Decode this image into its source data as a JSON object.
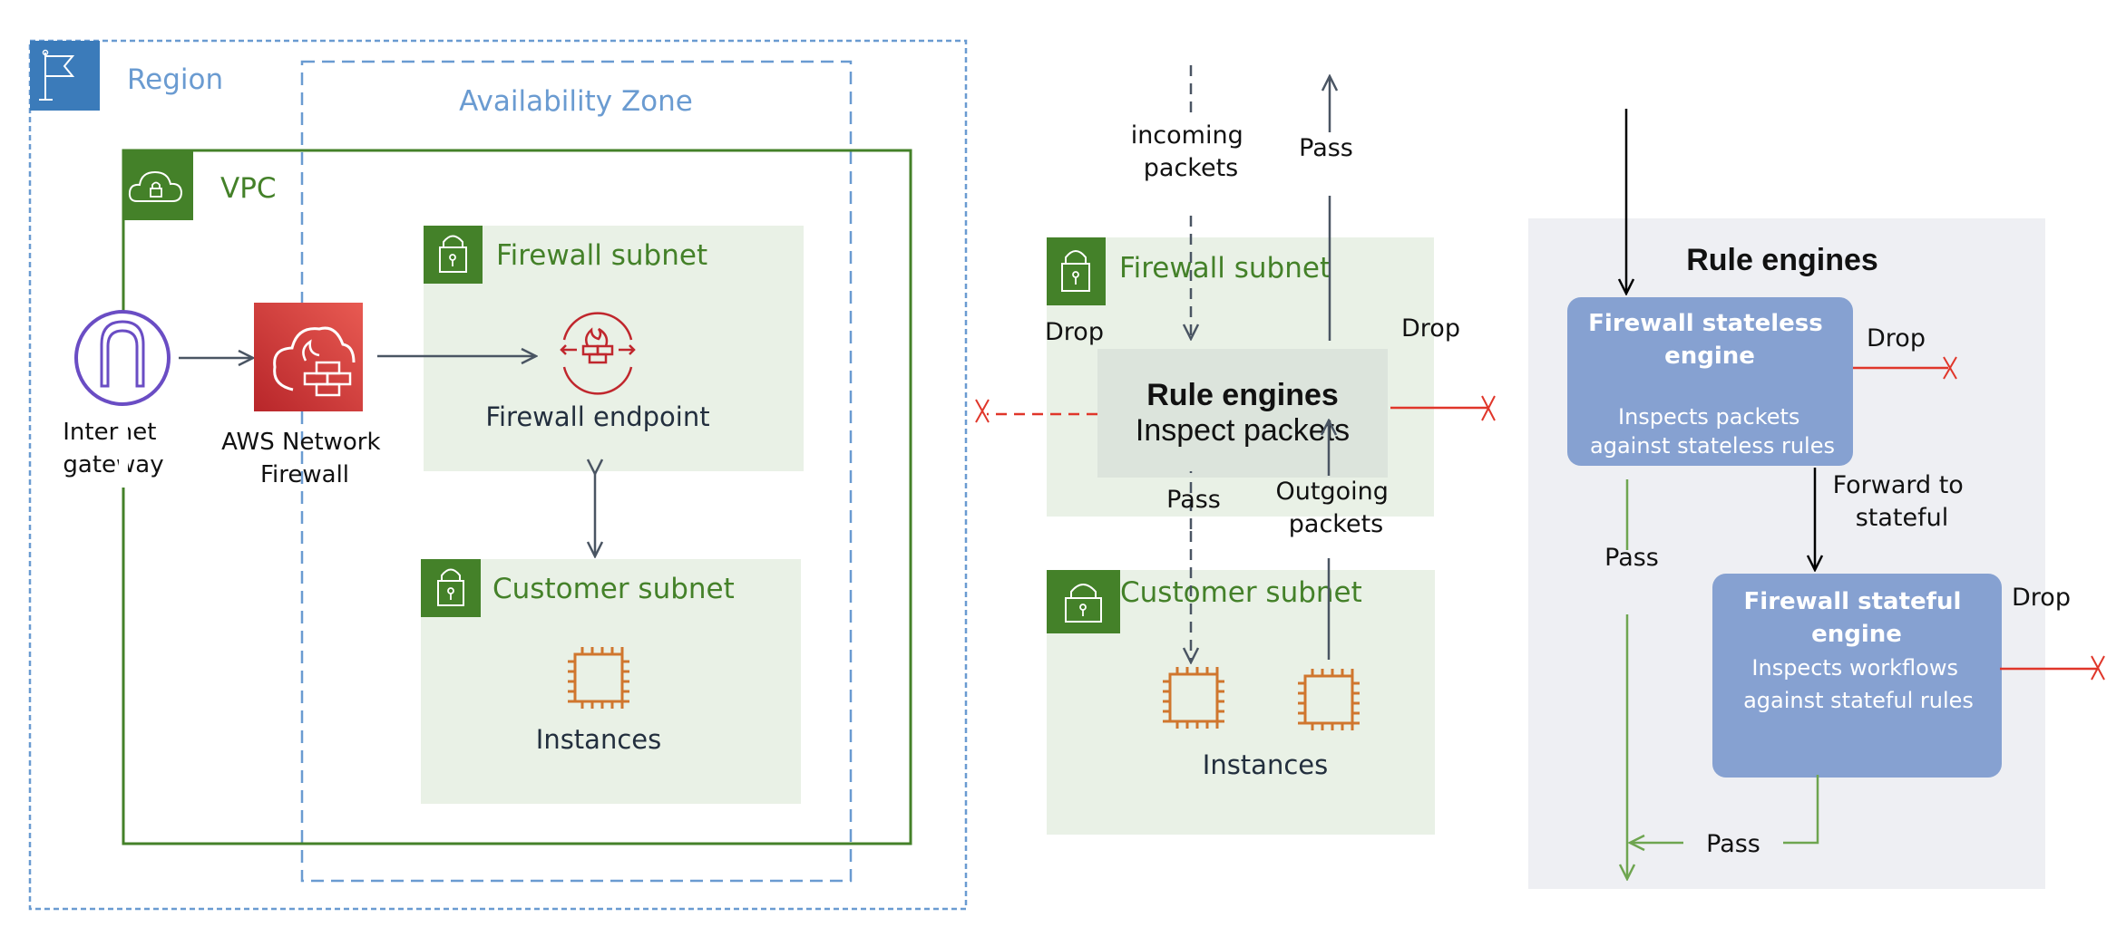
{
  "colors": {
    "region_blue": "#3b7bba",
    "dashed_blue": "#6a9bd1",
    "vpc_green": "#448129",
    "subnet_bg": "#e9f1e6",
    "rule_box_bg": "#dce4dc",
    "panel_grey": "#eeeff3",
    "engine_blue": "#86a1d1",
    "drop_red": "#e0362a",
    "pass_green": "#6ea550",
    "arrow_dark": "#4a5563",
    "gateway_purple": "#6a4dc4",
    "firewall_red": "#cc3333",
    "instance_orange": "#d0762e"
  },
  "architecture": {
    "region_label": "Region",
    "az_label": "Availability Zone",
    "vpc_label": "VPC",
    "internet_gateway": [
      "Internet",
      "gateway"
    ],
    "network_firewall": [
      "AWS Network",
      "Firewall"
    ],
    "firewall_subnet": {
      "label": "Firewall subnet",
      "endpoint_label": "Firewall endpoint"
    },
    "customer_subnet": {
      "label": "Customer subnet",
      "instances_label": "Instances"
    }
  },
  "packet_flow": {
    "incoming_label": [
      "incoming",
      "packets"
    ],
    "pass_top": "Pass",
    "firewall_subnet_label": "Firewall subnet",
    "rule_engines_title": "Rule engines",
    "rule_engines_subtitle": "Inspect packets",
    "drop_left": "Drop",
    "drop_right": "Drop",
    "pass_down": "Pass",
    "outgoing_label": [
      "Outgoing",
      "packets"
    ],
    "customer_subnet_label": "Customer subnet",
    "instances_label": "Instances"
  },
  "rule_engines": {
    "title": "Rule engines",
    "stateless": {
      "title": [
        "Firewall stateless",
        "engine"
      ],
      "desc": [
        "Inspects packets",
        "against stateless rules"
      ],
      "drop": "Drop"
    },
    "forward_label": [
      "Forward to",
      "stateful"
    ],
    "pass_left": "Pass",
    "stateful": {
      "title": [
        "Firewall stateful",
        "engine"
      ],
      "desc": [
        "Inspects workflows",
        "against stateful rules"
      ],
      "drop": "Drop"
    },
    "pass_bottom": "Pass"
  }
}
